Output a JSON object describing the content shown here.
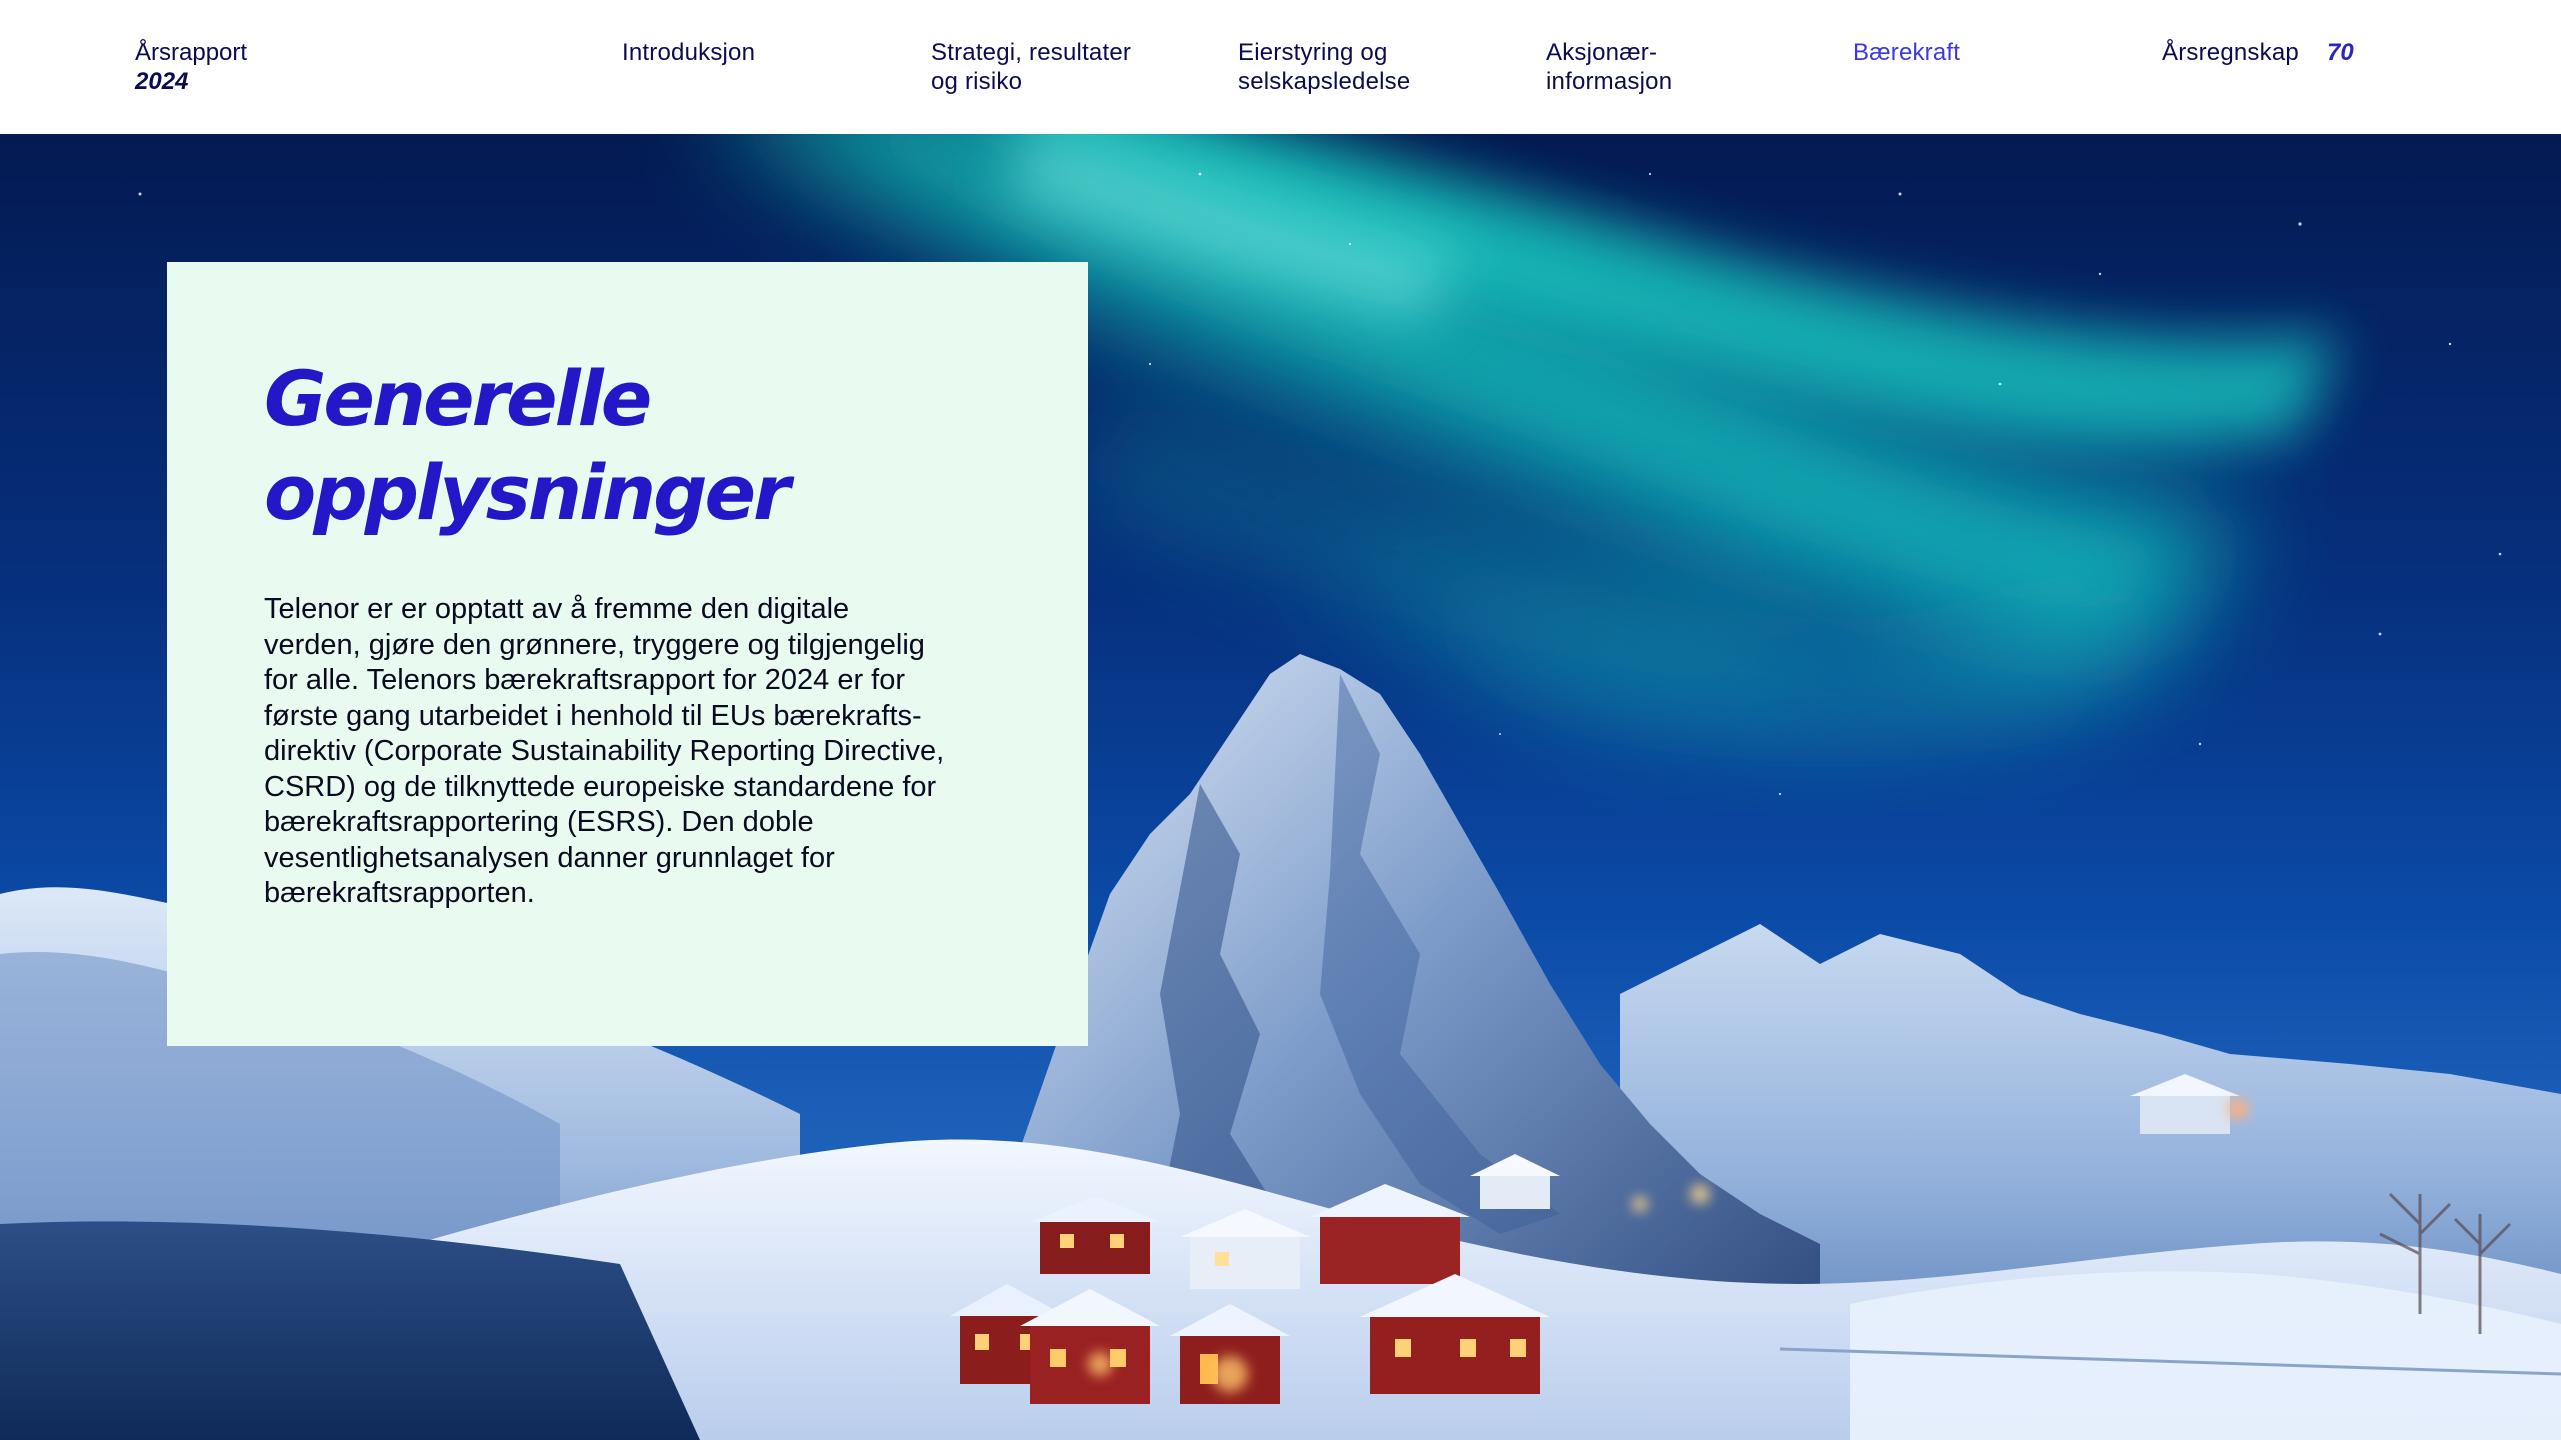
{
  "header": {
    "brand_line1": "Årsrapport",
    "brand_line2": "2024",
    "nav": [
      {
        "label": "Introduksjon",
        "active": false
      },
      {
        "label": "Strategi, resultater\nog risiko",
        "active": false
      },
      {
        "label": "Eierstyring og\nselskapsledelse",
        "active": false
      },
      {
        "label": "Aksjonær-\ninformasjon",
        "active": false
      },
      {
        "label": "Bærekraft",
        "active": true
      },
      {
        "label": "Årsregnskap",
        "active": false
      }
    ],
    "page_number": "70"
  },
  "card": {
    "title": "Generelle\nopplysninger",
    "body": "Telenor er er opptatt av å fremme den digitale\nverden, gjøre den grønnere, tryggere og tilgjengelig\nfor alle. Telenors bærekraftsrapport for 2024 er for\nførste gang utarbeidet i henhold til EUs bærekrafts-\ndirektiv (Corporate Sustainability Reporting Directive,\nCSRD) og de tilknyttede europeiske standardene for\nbærekraftsrapportering (ESRS). Den doble\nvesentlighetsanalysen danner grunnlaget for\nbærekraftsrapporten."
  },
  "colors": {
    "nav_text": "#0b0b50",
    "nav_active": "#3b39d9",
    "title_blue": "#2417c8",
    "card_bg": "#e9fbf0"
  }
}
